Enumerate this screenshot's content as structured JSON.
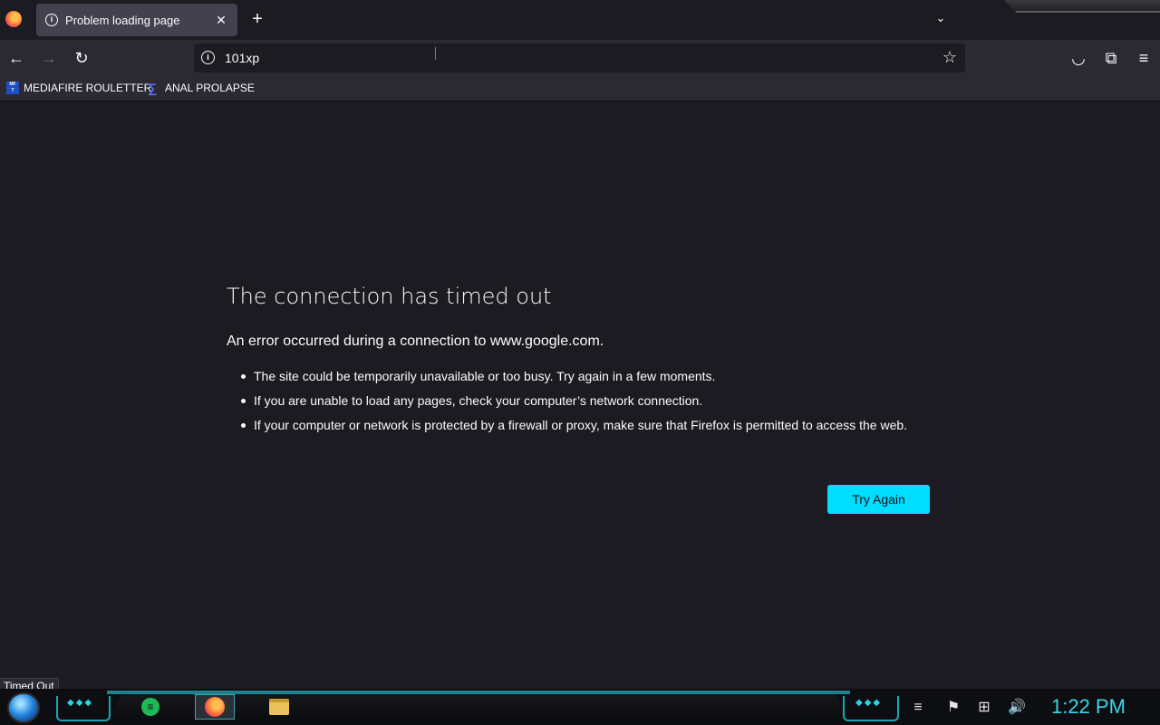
{
  "tab": {
    "title": "Problem loading page",
    "close": "✕",
    "new_tab": "+",
    "list_all": "⌄"
  },
  "nav": {
    "back": "←",
    "forward": "→",
    "reload": "↻",
    "url": "101xp",
    "star": "☆",
    "pocket": "◡",
    "extensions": "⧉",
    "menu": "≡"
  },
  "bookmarks": [
    {
      "label": "MEDIAFIRE ROULETTER",
      "icon": "mediafire-icon"
    },
    {
      "label": "ANAL PROLAPSE",
      "icon": "sigma-icon"
    }
  ],
  "error": {
    "title": "The connection has timed out",
    "description": "An error occurred during a connection to www.google.com.",
    "bullets": [
      "The site could be temporarily unavailable or too busy. Try again in a few moments.",
      "If you are unable to load any pages, check your computer’s network connection.",
      "If your computer or network is protected by a firewall or proxy, make sure that Firefox is permitted to access the web."
    ],
    "button": "Try Again"
  },
  "status_tooltip": "Timed Out",
  "taskbar": {
    "clock": "1:22 PM"
  },
  "colors": {
    "accent": "#00ddff",
    "page_bg": "#1c1b22",
    "toolbar_bg": "#2b2a33",
    "clock": "#3fd4e6"
  }
}
